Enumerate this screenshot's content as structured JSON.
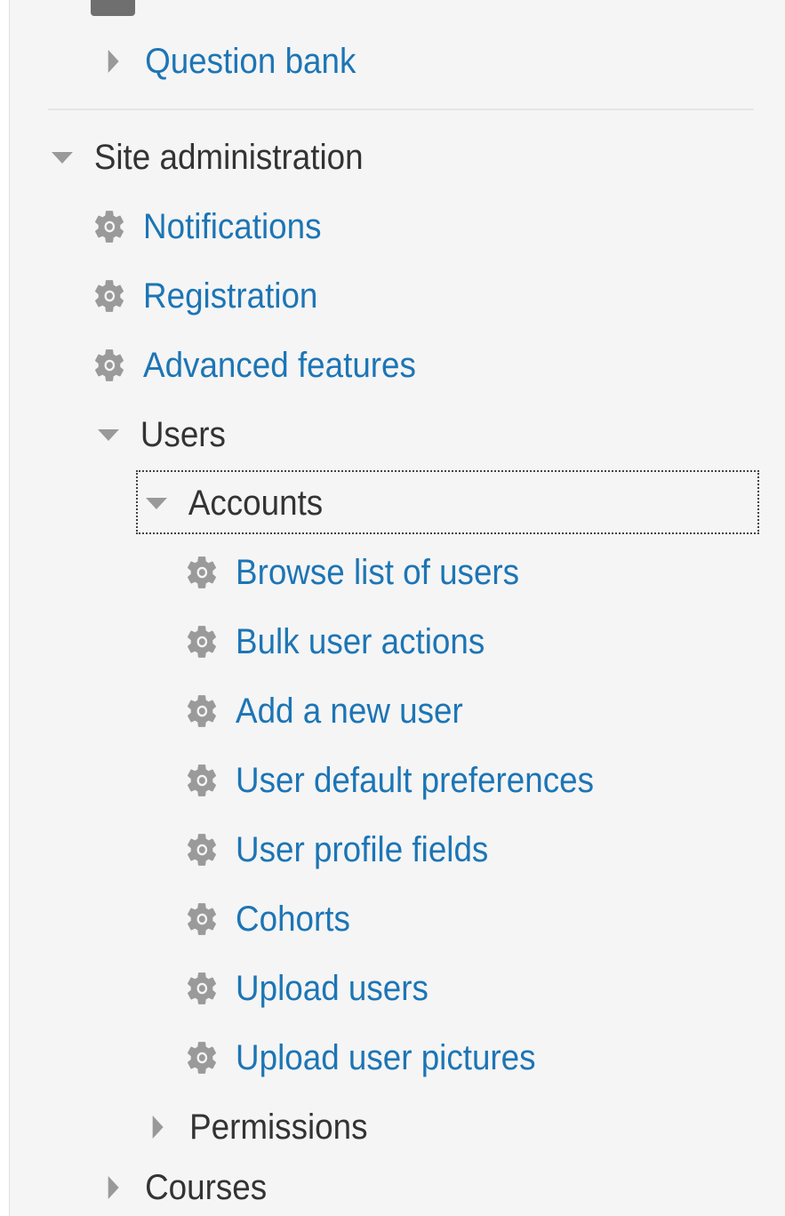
{
  "nav": {
    "question_bank": "Question bank",
    "site_administration": "Site administration",
    "notifications": "Notifications",
    "registration": "Registration",
    "advanced_features": "Advanced features",
    "users": "Users",
    "accounts": "Accounts",
    "accounts_items": [
      "Browse list of users",
      "Bulk user actions",
      "Add a new user",
      "User default preferences",
      "User profile fields",
      "Cohorts",
      "Upload users",
      "Upload user pictures"
    ],
    "permissions": "Permissions",
    "courses": "Courses"
  },
  "colors": {
    "link": "#1c75b5",
    "text": "#333333",
    "icon": "#999999",
    "background": "#f5f5f5"
  },
  "icons": {
    "collapsed": "caret-right-icon",
    "expanded": "caret-down-icon",
    "settings": "gear-icon"
  }
}
